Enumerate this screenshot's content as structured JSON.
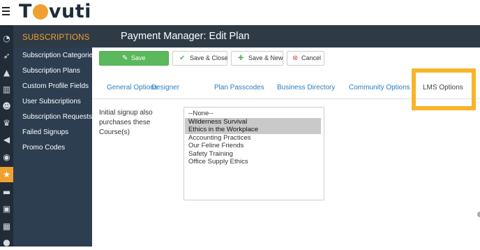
{
  "app": {
    "logo_text_pre": "T",
    "logo_text_post": "vuti",
    "brand_orange": "#f0a030",
    "sidebar_bg": "#2c3e50",
    "header_bg": "#2f3a47"
  },
  "icon_rail": [
    {
      "icon": "dashboard-icon",
      "glyph": "◔"
    },
    {
      "icon": "rocket-icon",
      "glyph": "➶"
    },
    {
      "icon": "graduation-cap-icon",
      "glyph": "▲"
    },
    {
      "icon": "bar-chart-icon",
      "glyph": "▥"
    },
    {
      "icon": "users-icon",
      "glyph": "☻"
    },
    {
      "icon": "trophy-icon",
      "glyph": "♛"
    },
    {
      "icon": "megaphone-icon",
      "glyph": "◀"
    },
    {
      "icon": "rss-icon",
      "glyph": "◉"
    },
    {
      "icon": "star-icon",
      "glyph": "★",
      "active": true
    },
    {
      "icon": "credit-card-icon",
      "glyph": "▬"
    },
    {
      "icon": "id-badge-icon",
      "glyph": "▣"
    },
    {
      "icon": "calendar-icon",
      "glyph": "▦"
    },
    {
      "icon": "chat-icon",
      "glyph": "●"
    }
  ],
  "sidebar": {
    "heading": "SUBSCRIPTIONS",
    "items": [
      {
        "label": "Subscription Categories"
      },
      {
        "label": "Subscription Plans"
      },
      {
        "label": "Custom Profile Fields"
      },
      {
        "label": "User Subscriptions"
      },
      {
        "label": "Subscription Requests"
      },
      {
        "label": "Failed Signups"
      },
      {
        "label": "Promo Codes"
      }
    ]
  },
  "header": {
    "title": "Payment Manager: Edit Plan"
  },
  "toolbar": {
    "save_label": "Save",
    "save_close_label": "Save & Close",
    "save_new_label": "Save & New",
    "cancel_label": "Cancel"
  },
  "tabs": [
    {
      "label": "General Options"
    },
    {
      "label": "Designer"
    },
    {
      "label": "Plan Passcodes"
    },
    {
      "label": "Business Directory"
    },
    {
      "label": "Community Options"
    },
    {
      "label": "LMS Options",
      "active": true
    }
  ],
  "lms": {
    "field_label": "Initial signup also purchases these Course(s)",
    "course_options": [
      {
        "label": "--None--",
        "selected": false
      },
      {
        "label": "Wilderness Survival",
        "selected": true
      },
      {
        "label": "Ethics in the Workplace",
        "selected": true
      },
      {
        "label": "Accounting Practices",
        "selected": false
      },
      {
        "label": "Our Feline Friends",
        "selected": false
      },
      {
        "label": "Safety Training",
        "selected": false
      },
      {
        "label": "Office Supply Ethics",
        "selected": false
      }
    ]
  }
}
